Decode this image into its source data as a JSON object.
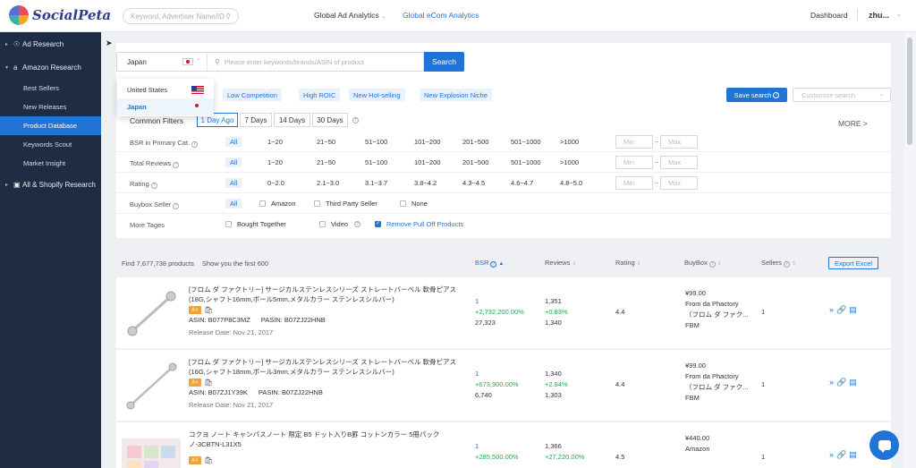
{
  "topbar": {
    "brand": "SocialPeta",
    "search_placeholder": "Keyword, Advertiser Name/ID",
    "tabs": [
      {
        "label": "Global Ad Analytics"
      },
      {
        "label": "Global eCom Analytics"
      }
    ],
    "dashboard": "Dashboard",
    "user": "zhu..."
  },
  "sidebar": {
    "sections": [
      {
        "label": "Ad Research"
      },
      {
        "label": "Amazon Research"
      },
      {
        "label": "All & Shopify Research"
      }
    ],
    "items": [
      {
        "label": "Best Sellers"
      },
      {
        "label": "New Releases"
      },
      {
        "label": "Product Database"
      },
      {
        "label": "Keywords Scout"
      },
      {
        "label": "Market Insight"
      }
    ]
  },
  "search": {
    "country": "Japan",
    "placeholder": "Please enter keywords/brands/ASIN of product",
    "button": "Search",
    "dropdown": [
      {
        "label": "United States"
      },
      {
        "label": "Japan"
      }
    ]
  },
  "presets": {
    "chips": [
      {
        "label": "Low Competition"
      },
      {
        "label": "High ROIC"
      },
      {
        "label": "New Hot-selling"
      },
      {
        "label": "New Explosion Niche"
      }
    ],
    "save": "Save search",
    "customize_placeholder": "Customize search"
  },
  "filters": {
    "common_label": "Common Filters",
    "days": [
      {
        "label": "1 Day Ago"
      },
      {
        "label": "7 Days"
      },
      {
        "label": "14 Days"
      },
      {
        "label": "30 Days"
      }
    ],
    "more": "MORE >",
    "min": "Min",
    "max": "Max",
    "bsr": {
      "label": "BSR in Primary Cat.",
      "options": [
        "All",
        "1~20",
        "21~50",
        "51~100",
        "101~200",
        "201~500",
        "501~1000",
        ">1000"
      ]
    },
    "reviews": {
      "label": "Total Reviews",
      "options": [
        "All",
        "1~20",
        "21~50",
        "51~100",
        "101~200",
        "201~500",
        "501~1000",
        ">1000"
      ]
    },
    "rating": {
      "label": "Rating",
      "options": [
        "All",
        "0~2.0",
        "2.1~3.0",
        "3.1~3.7",
        "3.8~4.2",
        "4.3~4.5",
        "4.6~4.7",
        "4.8~5.0"
      ]
    },
    "buybox": {
      "label": "Buybox Seller",
      "all": "All",
      "options": [
        "Amazon",
        "Third Party Seller",
        "None"
      ]
    },
    "tags": {
      "label": "More Tages",
      "options": [
        "Bought Together",
        "Video",
        "Remove Pull Off Products"
      ]
    }
  },
  "results": {
    "found": "Find 7,677,738 products",
    "showing": "Show you the first 600",
    "columns": {
      "bsr": "BSR",
      "reviews": "Reviews",
      "rating": "Rating",
      "buybox": "BuyBox",
      "sellers": "Sellers"
    },
    "export": "Export Excel",
    "products": [
      {
        "title": "[フロム ダ ファクトリー] サージカルステンレスシリーズ ストレートバーベル 軟骨ピアス (18G,シャフト16mm,ボール5mm,メタルカラー ステンレスシルバー)",
        "asin": "ASIN: B077P8C3MZ",
        "pasin": "PASIN: B07ZJ22HNB",
        "release": "Release Date: Nov 21, 2017",
        "bsr": "1",
        "bsr_change": "+2,732,200.00%",
        "bsr_prev": "27,323",
        "reviews": "1,351",
        "reviews_change": "+0.83%",
        "reviews_prev": "1,340",
        "rating": "4.4",
        "price": "¥99.00",
        "seller": "From da Phactory",
        "seller_jp": "（フロム ダ ファク...",
        "fulfillment": "FBM",
        "sellers": "1"
      },
      {
        "title": "[フロム ダ ファクトリー] サージカルステンレスシリーズ ストレートバーベル 軟骨ピアス (16G,シャフト18mm,ボール3mm,メタルカラー ステンレスシルバー)",
        "asin": "ASIN: B07ZJ1Y39K",
        "pasin": "PASIN: B07ZJ22HNB",
        "release": "Release Date: Nov 21, 2017",
        "bsr": "1",
        "bsr_change": "+673,900.00%",
        "bsr_prev": "6,740",
        "reviews": "1,340",
        "reviews_change": "+2.84%",
        "reviews_prev": "1,303",
        "rating": "4.4",
        "price": "¥99.00",
        "seller": "From da Phactory",
        "seller_jp": "（フロム ダ ファク...",
        "fulfillment": "FBM",
        "sellers": "1"
      },
      {
        "title": "コクヨ ノート キャンパスノート 限定 B5 ドット入りB罫 コットンカラー 5冊パック ノ-3CBTN-L31X5",
        "bsr": "1",
        "bsr_change": "+285,500.00%",
        "reviews": "1,366",
        "reviews_change": "+27,220.00%",
        "rating": "4.5",
        "price": "¥440.00",
        "seller": "Amazon",
        "sellers": "1"
      }
    ]
  },
  "colors": {
    "accent": "#1f74d6",
    "sidebar": "#1f2d44",
    "positive": "#2ea44f",
    "badge": "#f0a23a"
  },
  "icons": [
    "search-icon",
    "location-icon",
    "amazon-icon",
    "cart-icon",
    "help-icon",
    "chat-icon",
    "detail-icon",
    "link-icon",
    "report-icon"
  ]
}
